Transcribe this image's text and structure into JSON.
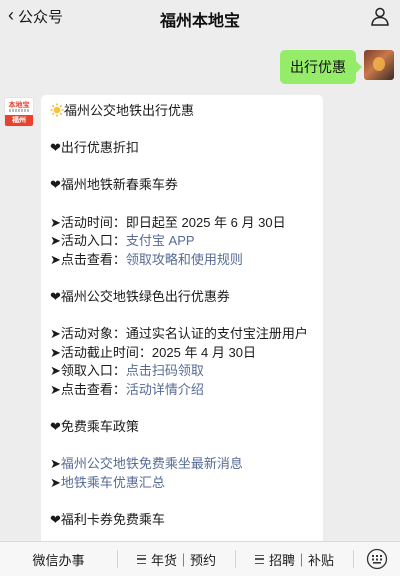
{
  "header": {
    "back_label": "公众号",
    "title": "福州本地宝"
  },
  "outgoing": {
    "text": "出行优惠"
  },
  "bot_avatar": {
    "logo_top": "本地宝",
    "logo_city": "福州"
  },
  "message": {
    "title": "福州公交地铁出行优惠",
    "section_main": "❤出行优惠折扣",
    "sec1": {
      "heading": "❤福州地铁新春乘车券",
      "time_label": "➤活动时间：",
      "time_value": "即日起至 2025 年 6 月 30日",
      "entry_label": "➤活动入口：",
      "entry_link": "支付宝 APP",
      "view_label": "➤点击查看：",
      "view_link": "领取攻略和使用规则"
    },
    "sec2": {
      "heading": "❤福州公交地铁绿色出行优惠券",
      "target_label": "➤活动对象：",
      "target_value": "通过实名认证的支付宝注册用户",
      "deadline_label": "➤活动截止时间：",
      "deadline_value": "2025 年 4 月 30日",
      "entry_label": "➤领取入口：",
      "entry_link": "点击扫码领取",
      "view_label": "➤点击查看：",
      "view_link": "活动详情介绍"
    },
    "sec3": {
      "heading": "❤免费乘车政策",
      "arrow1": "➤",
      "link1": "福州公交地铁免费乘坐最新消息",
      "arrow2": "➤",
      "link2": "地铁乘车优惠汇总"
    },
    "sec4": {
      "heading": "❤福利卡券免费乘车"
    }
  },
  "bottom_menu": {
    "item1": "微信办事",
    "item2": "年货｜预约",
    "item3": "招聘｜补贴"
  },
  "colors": {
    "bubble_out": "#95ec69",
    "link": "#576b95",
    "brand_red": "#e8432f"
  }
}
